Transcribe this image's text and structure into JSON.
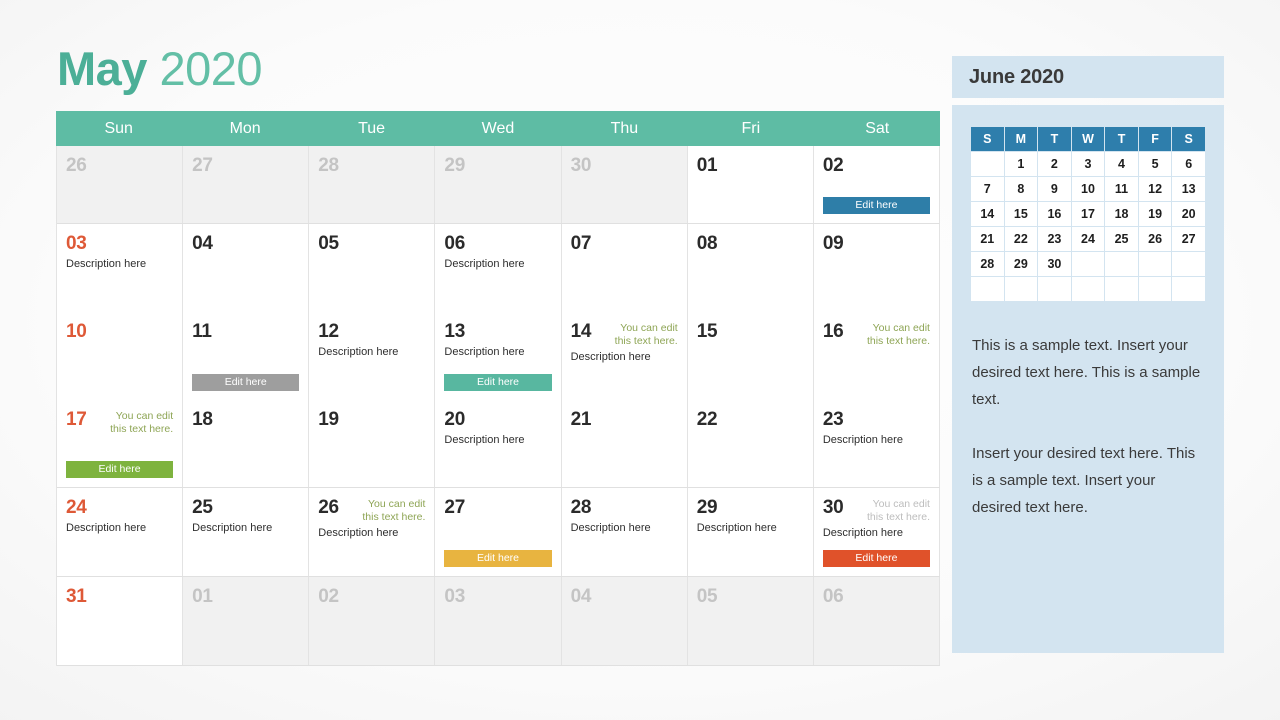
{
  "title": {
    "month": "May",
    "year": "2020"
  },
  "weekday_headers": [
    "Sun",
    "Mon",
    "Tue",
    "Wed",
    "Thu",
    "Fri",
    "Sat"
  ],
  "labels": {
    "edit_here": "Edit here",
    "description": "Description here",
    "note": "You can edit this text here."
  },
  "colors": {
    "teal_header": "#5EBCA4",
    "title_teal": "#4CAF97",
    "sunday_orange": "#DE5937",
    "note_olive": "#8EA555",
    "bar_blue": "#2E7EA8",
    "bar_gray": "#9E9E9E",
    "bar_teal": "#58B7A0",
    "bar_green": "#7EB33E",
    "bar_yellow": "#E8B440",
    "bar_orange": "#E0522A",
    "panel_blue": "#D3E4F0",
    "mini_header_blue": "#2E7EAC"
  },
  "weeks": [
    {
      "cells": [
        {
          "day": "26",
          "muted": true
        },
        {
          "day": "27",
          "muted": true
        },
        {
          "day": "28",
          "muted": true
        },
        {
          "day": "29",
          "muted": true
        },
        {
          "day": "30",
          "muted": true
        },
        {
          "day": "01"
        },
        {
          "day": "02",
          "bar": "blue",
          "bar_label": "Edit here"
        }
      ]
    },
    {
      "cells": [
        {
          "day": "03",
          "sunday": true,
          "desc": "Description here"
        },
        {
          "day": "04"
        },
        {
          "day": "05"
        },
        {
          "day": "06",
          "desc": "Description here"
        },
        {
          "day": "07"
        },
        {
          "day": "08"
        },
        {
          "day": "09"
        }
      ]
    },
    {
      "cells": [
        {
          "day": "10",
          "sunday": true
        },
        {
          "day": "11",
          "bar": "gray",
          "bar_label": "Edit here"
        },
        {
          "day": "12",
          "desc": "Description here"
        },
        {
          "day": "13",
          "desc": "Description here",
          "bar": "teal",
          "bar_label": "Edit here"
        },
        {
          "day": "14",
          "note": "You can edit this text here.",
          "desc": "Description here"
        },
        {
          "day": "15"
        },
        {
          "day": "16",
          "note": "You can edit this text here."
        }
      ]
    },
    {
      "cells": [
        {
          "day": "17",
          "sunday": true,
          "note": "You can edit this text here.",
          "bar": "green",
          "bar_label": "Edit here"
        },
        {
          "day": "18"
        },
        {
          "day": "19"
        },
        {
          "day": "20",
          "desc": "Description here"
        },
        {
          "day": "21"
        },
        {
          "day": "22"
        },
        {
          "day": "23",
          "desc": "Description here"
        }
      ]
    },
    {
      "cells": [
        {
          "day": "24",
          "sunday": true,
          "desc": "Description here"
        },
        {
          "day": "25",
          "desc": "Description here"
        },
        {
          "day": "26",
          "note": "You can edit this text here.",
          "desc": "Description here"
        },
        {
          "day": "27",
          "bar": "yellow",
          "bar_label": "Edit here"
        },
        {
          "day": "28",
          "desc": "Description here"
        },
        {
          "day": "29",
          "desc": "Description here"
        },
        {
          "day": "30",
          "note": "You can edit this text here.",
          "note_gray": true,
          "desc": "Description here",
          "bar": "orange",
          "bar_label": "Edit here"
        }
      ]
    },
    {
      "cells": [
        {
          "day": "31",
          "sunday": true
        },
        {
          "day": "01",
          "muted": true
        },
        {
          "day": "02",
          "muted": true
        },
        {
          "day": "03",
          "muted": true
        },
        {
          "day": "04",
          "muted": true
        },
        {
          "day": "05",
          "muted": true
        },
        {
          "day": "06",
          "muted": true
        }
      ]
    }
  ],
  "side_panel": {
    "header": "June 2020",
    "mini_calendar": {
      "weekday_headers": [
        "S",
        "M",
        "T",
        "W",
        "T",
        "F",
        "S"
      ],
      "rows": [
        [
          "",
          "1",
          "2",
          "3",
          "4",
          "5",
          "6"
        ],
        [
          "7",
          "8",
          "9",
          "10",
          "11",
          "12",
          "13"
        ],
        [
          "14",
          "15",
          "16",
          "17",
          "18",
          "19",
          "20"
        ],
        [
          "21",
          "22",
          "23",
          "24",
          "25",
          "26",
          "27"
        ],
        [
          "28",
          "29",
          "30",
          "",
          "",
          "",
          ""
        ],
        [
          "",
          "",
          "",
          "",
          "",
          "",
          ""
        ]
      ]
    },
    "paragraphs": [
      "This is a sample text. Insert your desired text here. This is a sample text.",
      "Insert your desired text here. This is a sample text. Insert your desired text here."
    ]
  }
}
